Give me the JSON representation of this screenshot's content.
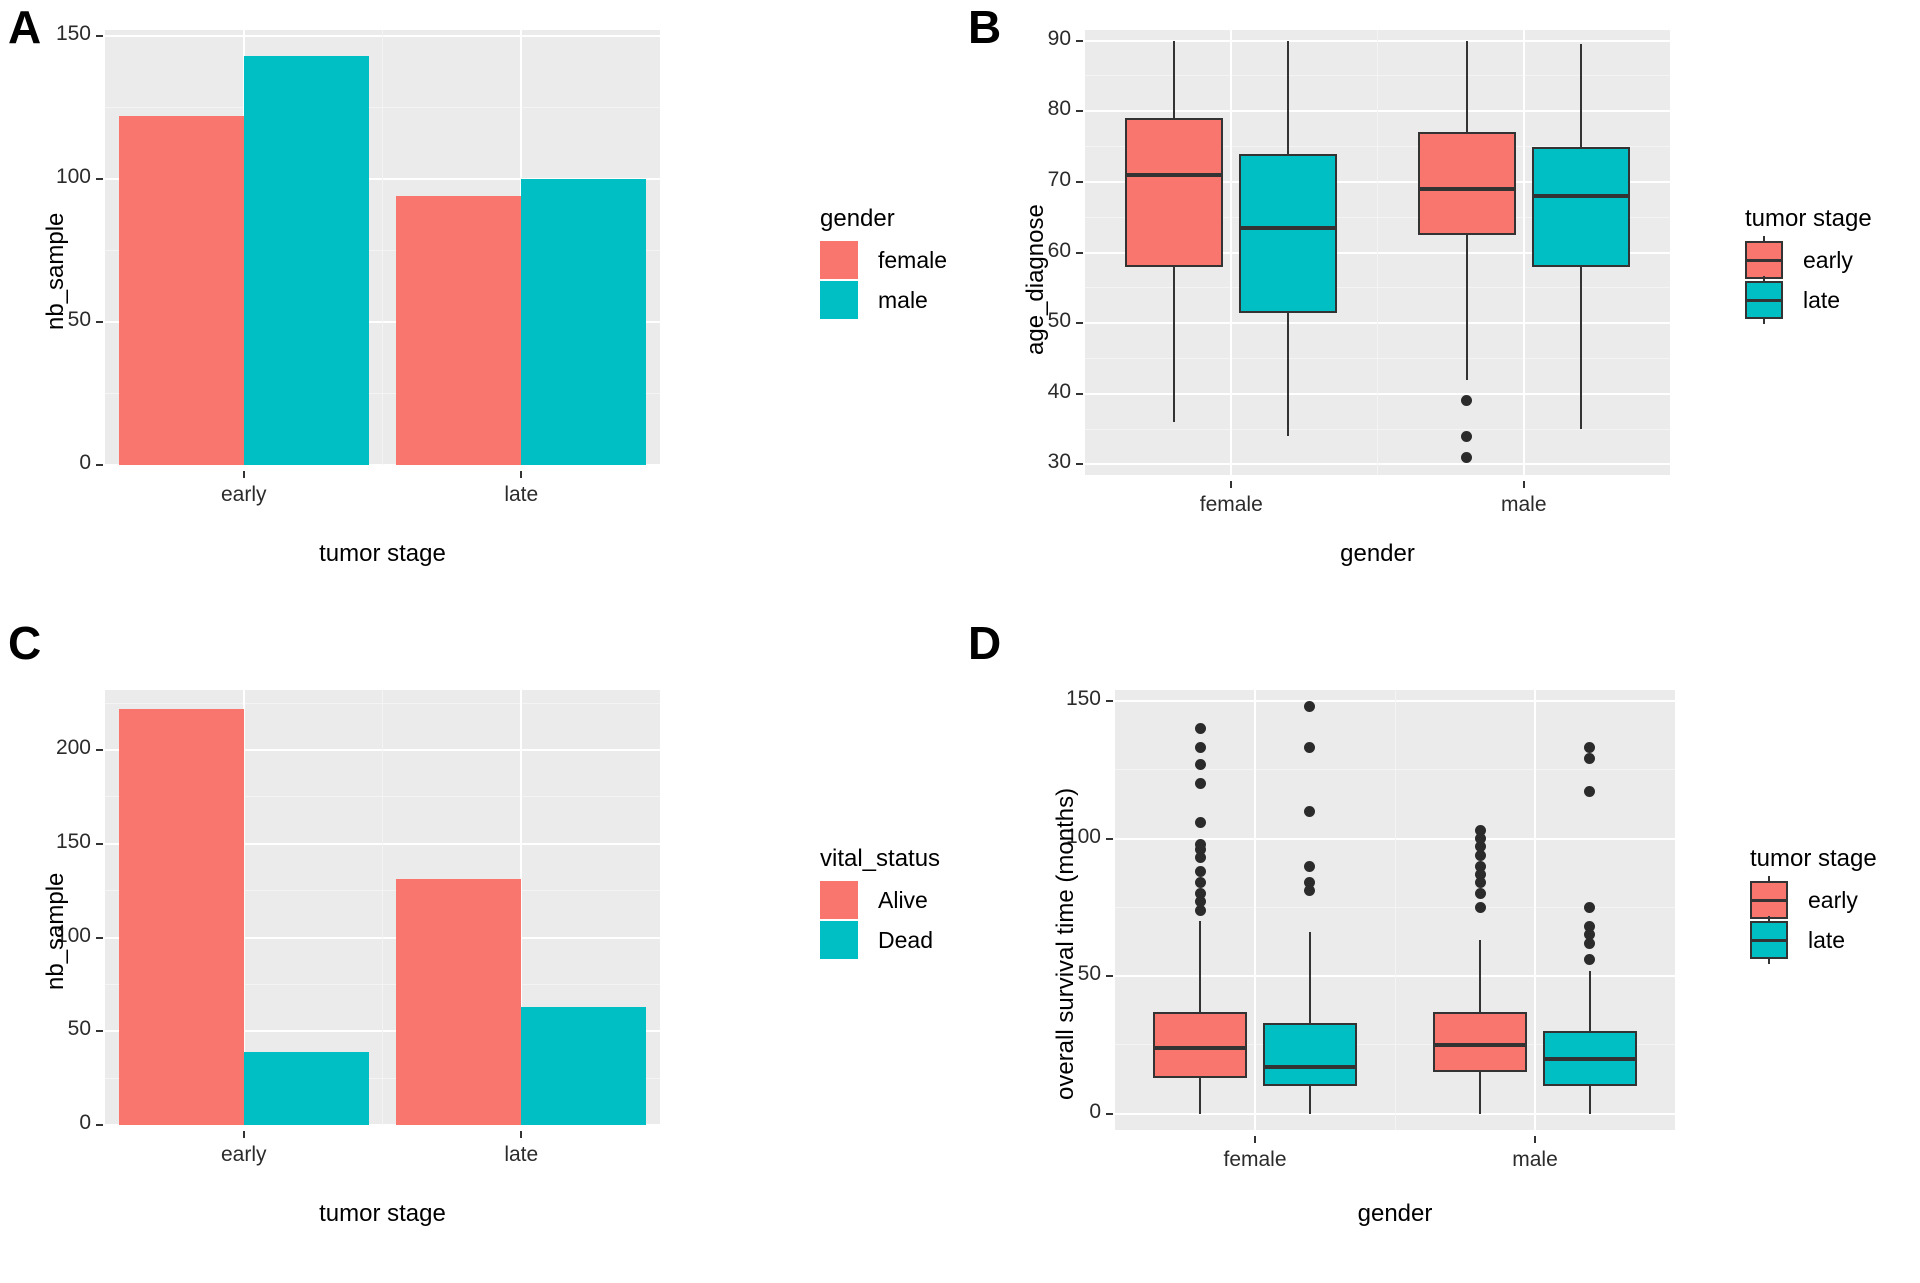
{
  "figure": {
    "panels": [
      "A",
      "B",
      "C",
      "D"
    ],
    "colors": {
      "salmon": "#F8766D",
      "teal": "#00BFC4",
      "panel_bg": "#EBEBEB",
      "grid": "#FFFFFF",
      "ink": "#333333"
    }
  },
  "panelA": {
    "letter": "A",
    "legend": {
      "title": "gender",
      "items": [
        {
          "label": "female",
          "color": "#F8766D"
        },
        {
          "label": "male",
          "color": "#00BFC4"
        }
      ]
    },
    "chart_data": {
      "type": "bar",
      "title": "",
      "xlabel": "tumor stage",
      "ylabel": "nb_sample",
      "categories": [
        "early",
        "late"
      ],
      "series": [
        {
          "name": "female",
          "color": "#F8766D",
          "values": [
            122,
            94
          ]
        },
        {
          "name": "male",
          "color": "#00BFC4",
          "values": [
            143,
            100
          ]
        }
      ],
      "ylim": [
        0,
        152
      ],
      "yticks": [
        0,
        50,
        100,
        150
      ],
      "ytick_labels": [
        "0",
        "50",
        "100",
        "150"
      ],
      "grid": true,
      "legend_position": "right"
    }
  },
  "panelB": {
    "letter": "B",
    "legend": {
      "title": "tumor stage",
      "items": [
        {
          "label": "early",
          "color": "#F8766D"
        },
        {
          "label": "late",
          "color": "#00BFC4"
        }
      ]
    },
    "chart_data": {
      "type": "boxplot",
      "title": "",
      "xlabel": "gender",
      "ylabel": "age_diagnose",
      "categories": [
        "female",
        "male"
      ],
      "ylim": [
        28.5,
        91.5
      ],
      "yticks": [
        30,
        40,
        50,
        60,
        70,
        80,
        90
      ],
      "ytick_labels": [
        "30",
        "40",
        "50",
        "60",
        "70",
        "80",
        "90"
      ],
      "grid": true,
      "legend_position": "right",
      "boxes": [
        {
          "group": "female",
          "stage": "early",
          "color": "#F8766D",
          "min": 36,
          "q1": 58,
          "median": 71,
          "q3": 79,
          "max": 90,
          "outliers": []
        },
        {
          "group": "female",
          "stage": "late",
          "color": "#00BFC4",
          "min": 34,
          "q1": 51.5,
          "median": 63.5,
          "q3": 74,
          "max": 90,
          "outliers": []
        },
        {
          "group": "male",
          "stage": "early",
          "color": "#F8766D",
          "min": 42,
          "q1": 62.5,
          "median": 69,
          "q3": 77,
          "max": 90,
          "outliers": [
            39,
            34,
            31
          ]
        },
        {
          "group": "male",
          "stage": "late",
          "color": "#00BFC4",
          "min": 35,
          "q1": 58,
          "median": 68,
          "q3": 75,
          "max": 89.5,
          "outliers": []
        }
      ]
    }
  },
  "panelC": {
    "letter": "C",
    "legend": {
      "title": "vital_status",
      "items": [
        {
          "label": "Alive",
          "color": "#F8766D"
        },
        {
          "label": "Dead",
          "color": "#00BFC4"
        }
      ]
    },
    "chart_data": {
      "type": "bar",
      "title": "",
      "xlabel": "tumor stage",
      "ylabel": "nb_sample",
      "categories": [
        "early",
        "late"
      ],
      "series": [
        {
          "name": "Alive",
          "color": "#F8766D",
          "values": [
            222,
            131
          ]
        },
        {
          "name": "Dead",
          "color": "#00BFC4",
          "values": [
            39,
            63
          ]
        }
      ],
      "ylim": [
        0,
        232
      ],
      "yticks": [
        0,
        50,
        100,
        150,
        200
      ],
      "ytick_labels": [
        "0",
        "50",
        "100",
        "150",
        "200"
      ],
      "grid": true,
      "legend_position": "right"
    }
  },
  "panelD": {
    "letter": "D",
    "legend": {
      "title": "tumor stage",
      "items": [
        {
          "label": "early",
          "color": "#F8766D"
        },
        {
          "label": "late",
          "color": "#00BFC4"
        }
      ]
    },
    "chart_data": {
      "type": "boxplot",
      "title": "",
      "xlabel": "gender",
      "ylabel": "overall survival time (months)",
      "categories": [
        "female",
        "male"
      ],
      "ylim": [
        -6,
        154
      ],
      "yticks": [
        0,
        50,
        100,
        150
      ],
      "ytick_labels": [
        "0",
        "50",
        "100",
        "150"
      ],
      "grid": true,
      "legend_position": "right",
      "boxes": [
        {
          "group": "female",
          "stage": "early",
          "color": "#F8766D",
          "min": 0,
          "q1": 13,
          "median": 24,
          "q3": 37,
          "max": 70,
          "outliers": [
            140,
            133,
            127,
            120,
            106,
            98,
            96,
            93,
            88,
            84,
            80,
            77,
            74
          ]
        },
        {
          "group": "female",
          "stage": "late",
          "color": "#00BFC4",
          "min": 0,
          "q1": 10,
          "median": 17,
          "q3": 33,
          "max": 66,
          "outliers": [
            148,
            133,
            110,
            90,
            84,
            81
          ]
        },
        {
          "group": "male",
          "stage": "early",
          "color": "#F8766D",
          "min": 0,
          "q1": 15,
          "median": 25,
          "q3": 37,
          "max": 63,
          "outliers": [
            103,
            100,
            97,
            94,
            90,
            87,
            84,
            80,
            75
          ]
        },
        {
          "group": "male",
          "stage": "late",
          "color": "#00BFC4",
          "min": 0,
          "q1": 10,
          "median": 20,
          "q3": 30,
          "max": 52,
          "outliers": [
            133,
            129,
            117,
            75,
            68,
            65,
            62,
            56
          ]
        }
      ]
    }
  }
}
